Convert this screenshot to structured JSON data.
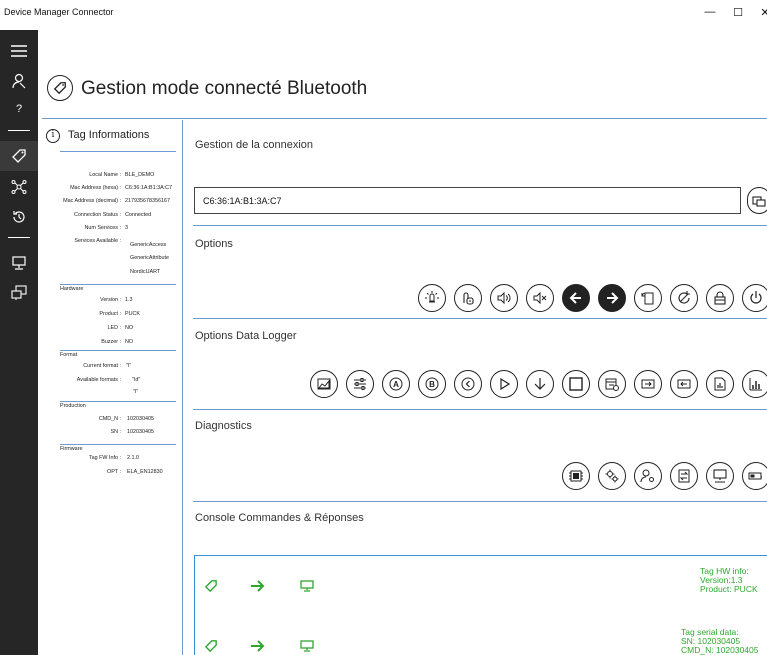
{
  "window": {
    "title": "Device Manager Connector",
    "minimize": "—",
    "maximize": "☐",
    "close": "✕"
  },
  "nav": [
    {
      "icon": "hamburger-menu-icon"
    },
    {
      "icon": "user-key-icon"
    },
    {
      "icon": "help-icon",
      "label": "?"
    },
    {
      "icon": "tag-icon",
      "active": true
    },
    {
      "icon": "network-icon"
    },
    {
      "icon": "history-icon"
    },
    {
      "icon": "monitor-icon"
    },
    {
      "icon": "device-sync-icon"
    }
  ],
  "page": {
    "title": "Gestion mode connecté Bluetooth",
    "icon": "tag-icon"
  },
  "tag_info": {
    "heading": "Tag Informations",
    "general": [
      {
        "label": "Local Name :",
        "value": "BLE_DEMO"
      },
      {
        "label": "Mac Address (hexa) :",
        "value": "C6:36:1A:B1:3A:C7"
      },
      {
        "label": "Mac Address (decimal) :",
        "value": "217935678356167"
      },
      {
        "label": "Connection Status :",
        "value": "Connected"
      },
      {
        "label": "Num Services :",
        "value": "3"
      }
    ],
    "services_label": "Services Available :",
    "services": [
      "GenericAccess",
      "GenericAttribute",
      "NordicUART"
    ],
    "hardware": {
      "label": "Hardware",
      "rows": [
        {
          "label": "Version :",
          "value": "1.3"
        },
        {
          "label": "Product :",
          "value": "PUCK"
        },
        {
          "label": "LED :",
          "value": "NO"
        },
        {
          "label": "Buzzer :",
          "value": "NO"
        }
      ]
    },
    "format": {
      "label": "Format",
      "current_label": "Current format :",
      "current_value": "\"I\"",
      "available_label": "Available formats :",
      "available_values": [
        "\"Id\"",
        "\"I\""
      ]
    },
    "production": {
      "label": "Production",
      "rows": [
        {
          "label": "CMD_N :",
          "value": "102030405"
        },
        {
          "label": "SN :",
          "value": "102030405"
        }
      ]
    },
    "firmware": {
      "label": "Firmware",
      "rows": [
        {
          "label": "Tag FW Info :",
          "value": "2.1.0"
        },
        {
          "label": "OPT :",
          "value": "ELA_EN12830"
        }
      ]
    }
  },
  "sections": {
    "connection": "Gestion de la connexion",
    "options": "Options",
    "datalogger": "Options Data Logger",
    "diagnostics": "Diagnostics",
    "console": "Console Commandes & Réponses"
  },
  "connection": {
    "address_value": "C6:36:1A:B1:3A:C7"
  },
  "options_buttons": [
    "led-icon",
    "finger-on-icon",
    "sound-on-icon",
    "sound-mute-icon",
    "arrow-left-icon",
    "arrow-right-icon",
    "reset-icon",
    "refresh-icon",
    "lock-icon",
    "power-icon"
  ],
  "datalogger_buttons": [
    "chart-area-icon",
    "equalizer-icon",
    "letter-a-icon",
    "letter-b-icon",
    "chevron-left-icon",
    "play-icon",
    "arrow-down-icon",
    "stop-icon",
    "calendar-icon",
    "log-export-icon",
    "log-import-icon",
    "report-icon",
    "chart-bar-icon"
  ],
  "diagnostics_buttons": [
    "chip-icon",
    "settings-icon",
    "user-settings-icon",
    "sync-icon",
    "computer-icon",
    "battery-icon"
  ],
  "console": {
    "messages": [
      {
        "lines": [
          "Tag HW info:",
          "Version:1.3",
          "Product: PUCK"
        ]
      },
      {
        "lines": [
          "Tag serial data:",
          "SN: 102030405",
          "CMD_N: 102030405"
        ]
      }
    ]
  },
  "colors": {
    "nav_bg": "#262626",
    "divider": "#6f9bd0",
    "console_border": "#3b8fd8",
    "console_text": "#2ea82e"
  }
}
